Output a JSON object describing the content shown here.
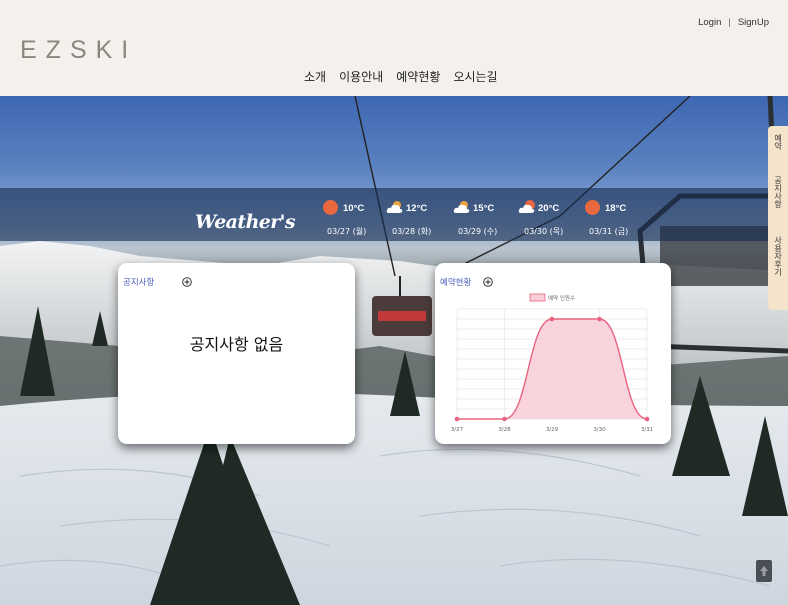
{
  "brand": {
    "logo": "EZSKI"
  },
  "auth": {
    "login": "Login",
    "separator": "|",
    "signup": "SignUp"
  },
  "nav": {
    "items": [
      "소개",
      "이용안내",
      "예약현황",
      "오시는길"
    ]
  },
  "weather": {
    "title": "Weather's",
    "days": [
      {
        "icon": "sun-icon",
        "temp": "10°C",
        "date": "03/27 (월)"
      },
      {
        "icon": "partly-cloudy-icon",
        "temp": "12°C",
        "date": "03/28 (화)"
      },
      {
        "icon": "partly-cloudy-icon",
        "temp": "15°C",
        "date": "03/29 (수)"
      },
      {
        "icon": "sun-cloud-icon",
        "temp": "20°C",
        "date": "03/30 (목)"
      },
      {
        "icon": "sun-icon",
        "temp": "18°C",
        "date": "03/31 (금)"
      }
    ]
  },
  "side_tabs": [
    "예약",
    "공지사항",
    "사용자후기"
  ],
  "notice": {
    "title": "공지사항",
    "empty_text": "공지사항 없음"
  },
  "reservation": {
    "title": "예약현황"
  },
  "chart_data": {
    "type": "area",
    "categories": [
      "3/27",
      "3/28",
      "3/29",
      "3/30",
      "3/31"
    ],
    "series": [
      {
        "name": "예약 인원수",
        "values": [
          0,
          0,
          10,
          10,
          0
        ]
      }
    ],
    "ylim": [
      0,
      11
    ],
    "grid": true,
    "legend": "top-center",
    "colors": {
      "line": "#e8637f",
      "fill": "#f9cdd6",
      "grid": "#e6e6e6"
    }
  },
  "colors": {
    "header_bg": "#f4f1ec",
    "accent_blue": "#4a5fbd",
    "side_tab_bg": "#f4e4cc",
    "sun": "#e9683f"
  }
}
